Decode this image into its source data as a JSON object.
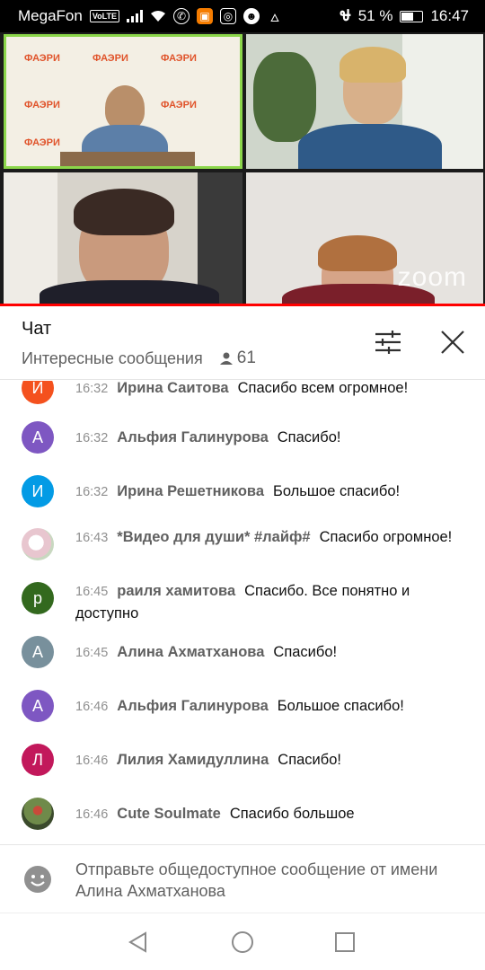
{
  "status_bar": {
    "carrier": "MegaFon",
    "volte": "VoLTE",
    "battery_text": "51 %",
    "time": "16:47"
  },
  "chat": {
    "title": "Чат",
    "mode": "Интересные сообщения",
    "viewer_count": "61"
  },
  "messages": [
    {
      "avatar_letter": "И",
      "avatar_color": "#f4511e",
      "time": "16:32",
      "author": "Ирина Саитова",
      "text": "Спасибо всем огромное!"
    },
    {
      "avatar_letter": "А",
      "avatar_color": "#7e57c2",
      "time": "16:32",
      "author": "Альфия Галинурова",
      "text": "Спасибо!"
    },
    {
      "avatar_letter": "И",
      "avatar_color": "#039be5",
      "time": "16:32",
      "author": "Ирина Решетникова",
      "text": "Большое спасибо!"
    },
    {
      "avatar_letter": "",
      "avatar_color": "#e6d9dc",
      "time": "16:43",
      "author": "*Видео для души* #лайф#",
      "text": "Спасибо огромное!"
    },
    {
      "avatar_letter": "р",
      "avatar_color": "#33691e",
      "time": "16:45",
      "author": "раиля хамитова",
      "text": "Спасибо. Все понятно и доступно"
    },
    {
      "avatar_letter": "А",
      "avatar_color": "#78909c",
      "time": "16:45",
      "author": "Алина Ахматханова",
      "text": "Спасибо!"
    },
    {
      "avatar_letter": "А",
      "avatar_color": "#7e57c2",
      "time": "16:46",
      "author": "Альфия Галинурова",
      "text": "Большое спасибо!"
    },
    {
      "avatar_letter": "Л",
      "avatar_color": "#c2185b",
      "time": "16:46",
      "author": "Лилия Хамидуллина",
      "text": "Спасибо!"
    },
    {
      "avatar_letter": "",
      "avatar_color": "#4a5a3a",
      "time": "16:46",
      "author": "Cute Soulmate",
      "text": "Спасибо большое"
    }
  ],
  "input": {
    "placeholder": "Отправьте общедоступное сообщение от имени Алина Ахматханова"
  },
  "video": {
    "watermark": "zoom"
  }
}
